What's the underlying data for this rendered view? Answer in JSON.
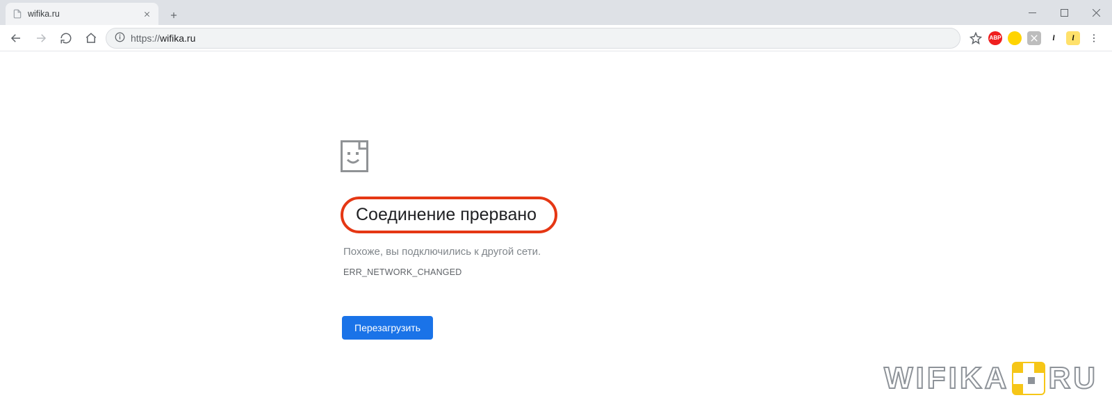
{
  "browser": {
    "tab": {
      "title": "wifika.ru"
    },
    "address": {
      "scheme": "https://",
      "host": "wifika.ru"
    }
  },
  "extensions": {
    "abp": "ABP",
    "l1": "l",
    "l2": "l"
  },
  "error": {
    "title": "Соединение прервано",
    "subtitle": "Похоже, вы подключились к другой сети.",
    "code": "ERR_NETWORK_CHANGED",
    "reload_label": "Перезагрузить"
  },
  "watermark": {
    "part1": "WIFIKA",
    "part2": "RU"
  }
}
